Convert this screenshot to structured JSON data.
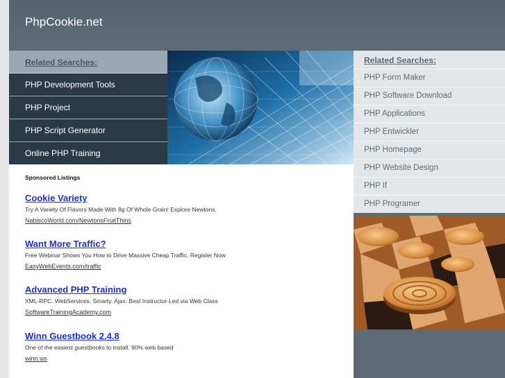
{
  "header": {
    "site_title": "PhpCookie.net"
  },
  "left_related": {
    "heading": "Related Searches:",
    "items": [
      {
        "label": "PHP Development Tools"
      },
      {
        "label": "PHP Project"
      },
      {
        "label": "PHP Script Generator"
      },
      {
        "label": "Online PHP Training"
      }
    ]
  },
  "right_related": {
    "heading": "Related Searches:",
    "items": [
      {
        "label": "PHP Form Maker"
      },
      {
        "label": "PHP Software Download"
      },
      {
        "label": "PHP Applications"
      },
      {
        "label": "PHP Entwickler"
      },
      {
        "label": "PHP Homepage"
      },
      {
        "label": "PHP Website Design"
      },
      {
        "label": "PHP If"
      },
      {
        "label": "PHP Programer"
      }
    ]
  },
  "sponsored": {
    "heading": "Sponsored Listings",
    "listings": [
      {
        "title": "Cookie Variety",
        "description": "Try A Variety Of Flavors Made With 8g Of Whole Grain! Explore Newtons.",
        "url": "NabiscoWorld.com/NewtonsFruitThins"
      },
      {
        "title": "Want More Traffic?",
        "description": "Free Webinar Shows You How to Drive Massive Cheap Traffic. Register Now",
        "url": "EasyWebEvents.com/traffic"
      },
      {
        "title": "Advanced PHP Training",
        "description": "XML-RPC. WebServices. Smarty. Ajax. Best Instructor-Led via Web Class",
        "url": "SoftwareTrainingAcademy.com"
      },
      {
        "title": "Winn Guestbook 2.4.8",
        "description": "One of the easiest guestbooks to install. 90% web based",
        "url": "winn.ws"
      }
    ]
  }
}
